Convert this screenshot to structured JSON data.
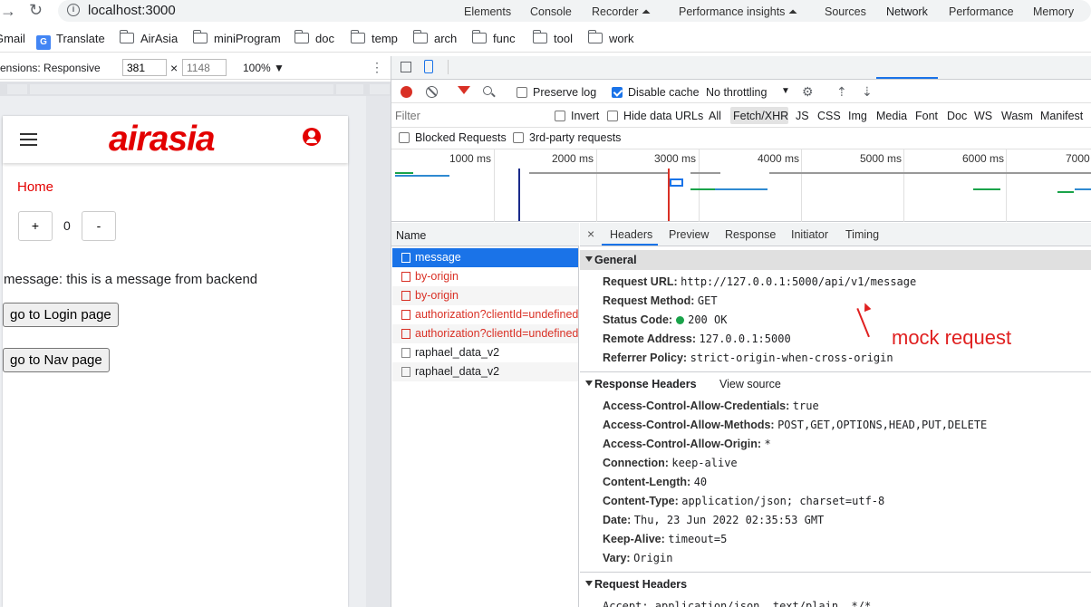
{
  "browser": {
    "url": "localhost:3000",
    "bookmarks": [
      "Gmail",
      "Translate",
      "AirAsia",
      "miniProgram",
      "doc",
      "temp",
      "arch",
      "func",
      "tool",
      "work"
    ]
  },
  "device_toolbar": {
    "dimensions_label": "ensions: Responsive",
    "width": "381",
    "height_placeholder": "1148",
    "times": "×",
    "zoom": "100% ▼"
  },
  "app": {
    "logo": "airasia",
    "nav_home": "Home",
    "counter": {
      "plus": "+",
      "value": "0",
      "minus": "-"
    },
    "message": "message: this is a message from backend",
    "login_button": "go to Login page",
    "nav_button": "go to Nav page"
  },
  "devtools": {
    "tabs": [
      "Elements",
      "Console",
      "Recorder ⏶",
      "Performance insights ⏶",
      "Sources",
      "Network",
      "Performance",
      "Memory"
    ],
    "active_tab": "Network",
    "toolbar": {
      "preserve_log": "Preserve log",
      "disable_cache": "Disable cache",
      "throttling": "No throttling",
      "throttling_arrow": "▼"
    },
    "filter": {
      "placeholder": "Filter",
      "invert": "Invert",
      "hide_data_urls": "Hide data URLs",
      "types": [
        "All",
        "Fetch/XHR",
        "JS",
        "CSS",
        "Img",
        "Media",
        "Font",
        "Doc",
        "WS",
        "Wasm",
        "Manifest"
      ],
      "active_type": "Fetch/XHR",
      "blocked_requests": "Blocked Requests",
      "third_party": "3rd-party requests"
    },
    "timeline": {
      "ticks": [
        "1000 ms",
        "2000 ms",
        "3000 ms",
        "4000 ms",
        "5000 ms",
        "6000 ms",
        "7000"
      ]
    },
    "requests": {
      "header": "Name",
      "items": [
        {
          "name": "message",
          "status": "selected"
        },
        {
          "name": "by-origin",
          "status": "error"
        },
        {
          "name": "by-origin",
          "status": "error"
        },
        {
          "name": "authorization?clientId=undefined",
          "status": "error"
        },
        {
          "name": "authorization?clientId=undefined",
          "status": "error"
        },
        {
          "name": "raphael_data_v2",
          "status": "ok"
        },
        {
          "name": "raphael_data_v2",
          "status": "ok"
        }
      ]
    },
    "details": {
      "close": "×",
      "tabs": [
        "Headers",
        "Preview",
        "Response",
        "Initiator",
        "Timing"
      ],
      "active_tab": "Headers",
      "general": {
        "title": "General",
        "rows": [
          {
            "key": "Request URL:",
            "value": "http://127.0.0.1:5000/api/v1/message"
          },
          {
            "key": "Request Method:",
            "value": "GET"
          },
          {
            "key": "Status Code:",
            "value": "200 OK"
          },
          {
            "key": "Remote Address:",
            "value": "127.0.0.1:5000"
          },
          {
            "key": "Referrer Policy:",
            "value": "strict-origin-when-cross-origin"
          }
        ]
      },
      "response_headers": {
        "title": "Response Headers",
        "view_source": "View source",
        "rows": [
          {
            "key": "Access-Control-Allow-Credentials:",
            "value": "true"
          },
          {
            "key": "Access-Control-Allow-Methods:",
            "value": "POST,GET,OPTIONS,HEAD,PUT,DELETE"
          },
          {
            "key": "Access-Control-Allow-Origin:",
            "value": "*"
          },
          {
            "key": "Connection:",
            "value": "keep-alive"
          },
          {
            "key": "Content-Length:",
            "value": "40"
          },
          {
            "key": "Content-Type:",
            "value": "application/json; charset=utf-8"
          },
          {
            "key": "Date:",
            "value": "Thu, 23 Jun 2022 02:35:53 GMT"
          },
          {
            "key": "Keep-Alive:",
            "value": "timeout=5"
          },
          {
            "key": "Vary:",
            "value": "Origin"
          }
        ]
      },
      "request_headers": {
        "title": "Request Headers",
        "first_row": "Accept: application/json, text/plain, */*"
      }
    },
    "annotation": "mock request"
  },
  "colors": {
    "brand_red": "#e30000",
    "accent_blue": "#1a73e8",
    "error_red": "#d93025",
    "status_green": "#1aa34a"
  }
}
